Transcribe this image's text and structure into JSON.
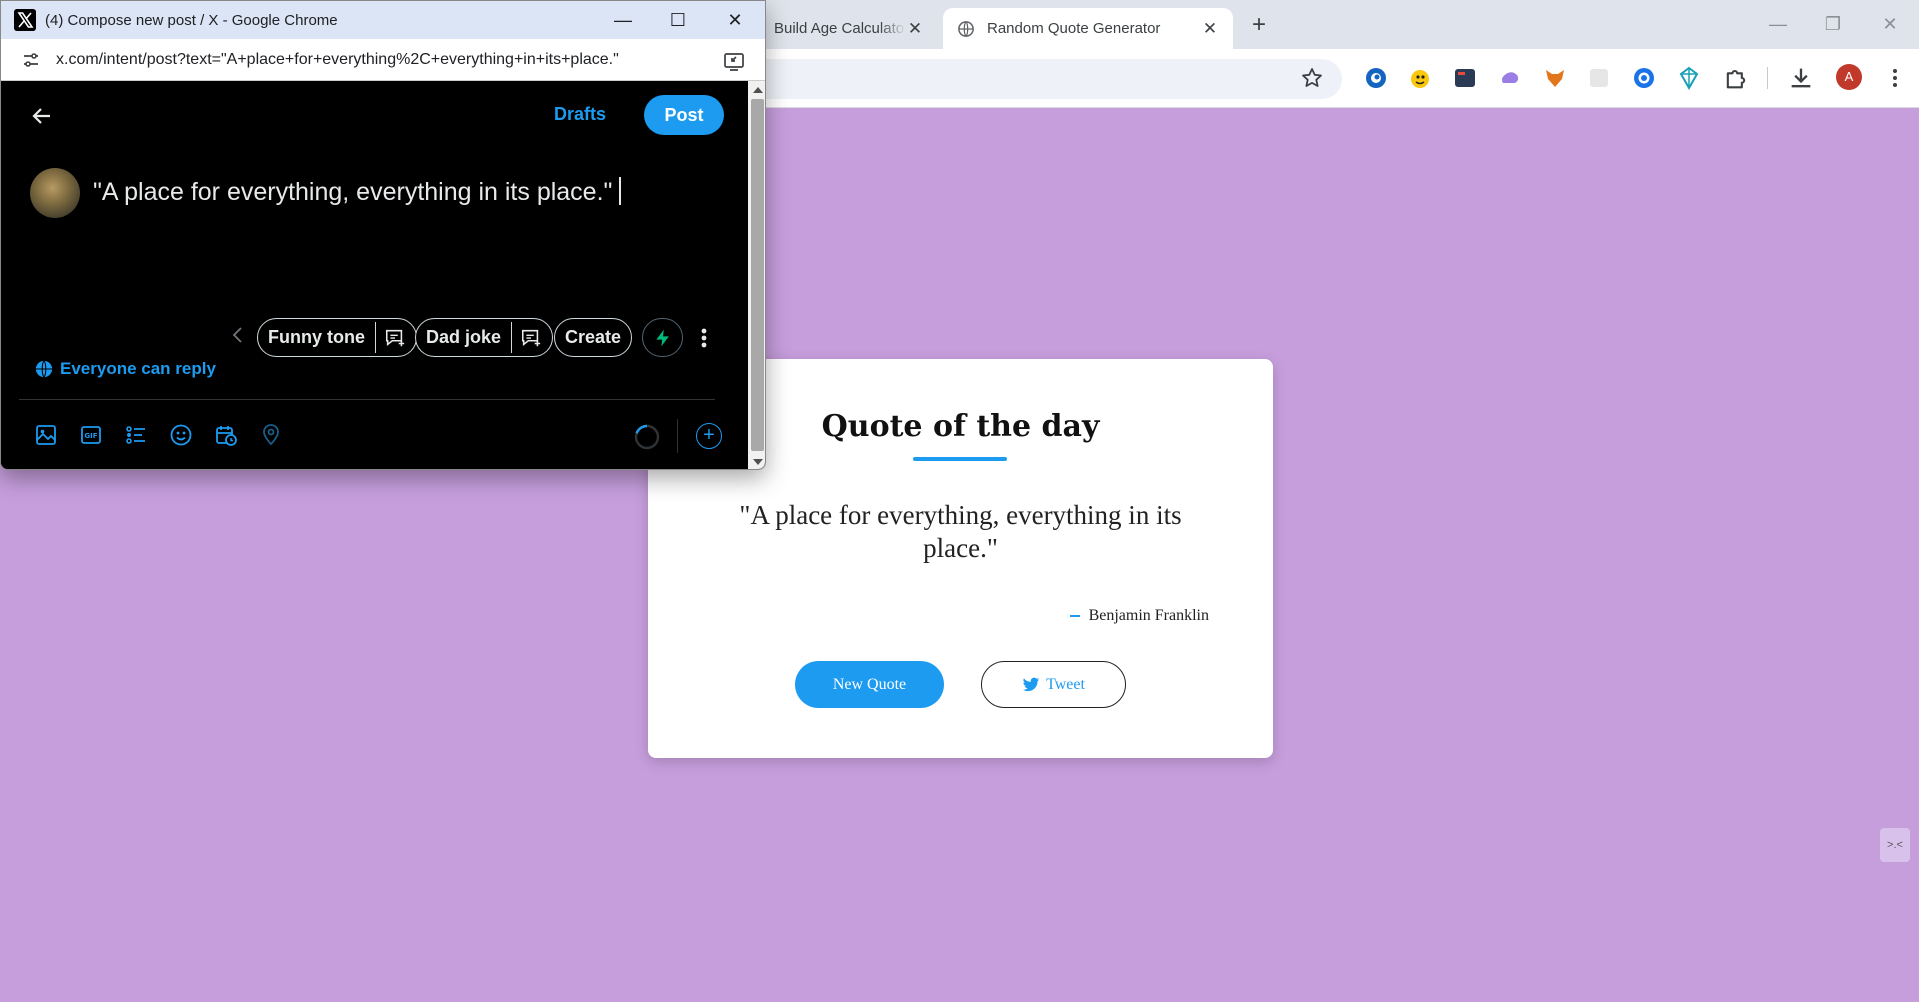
{
  "browser": {
    "tabs": [
      {
        "title": "Build Age Calculato",
        "close": "✕"
      },
      {
        "title": "Random Quote Generator",
        "close": "✕"
      }
    ],
    "new_tab": "+",
    "profile_initial": "A",
    "window_controls": {
      "minimize": "—",
      "restore": "❐",
      "close": "✕"
    },
    "extensions": [
      "circle-swirl-ext-icon",
      "duck-ext-icon",
      "dark-square-ext-icon",
      "purple-cloud-ext-icon",
      "fox-ext-icon",
      "grey-tile-ext-icon",
      "blue-ring-ext-icon",
      "teal-gem-ext-icon"
    ],
    "colors": {
      "page_bg": "#c69edc",
      "accent": "#1d9bf0"
    }
  },
  "page": {
    "card_title": "Quote of the day",
    "quote": "\"A place for everything, everything in its place.\"",
    "author": "Benjamin Franklin",
    "new_quote_label": "New Quote",
    "tweet_label": "Tweet",
    "widget_glyph": ">.<"
  },
  "popup": {
    "window_title": "(4) Compose new post / X - Google Chrome",
    "url": "x.com/intent/post?text=\"A+place+for+everything%2C+everything+in+its+place.\"",
    "controls": {
      "minimize": "—",
      "maximize": "☐",
      "close": "✕"
    },
    "compose": {
      "drafts_label": "Drafts",
      "post_label": "Post",
      "text": "\"A place for everything, everything in its place.\"",
      "chips": [
        {
          "label": "Funny tone"
        },
        {
          "label": "Dad joke"
        },
        {
          "label": "Create"
        }
      ],
      "reply_setting": "Everyone can reply",
      "add_label": "+"
    }
  }
}
